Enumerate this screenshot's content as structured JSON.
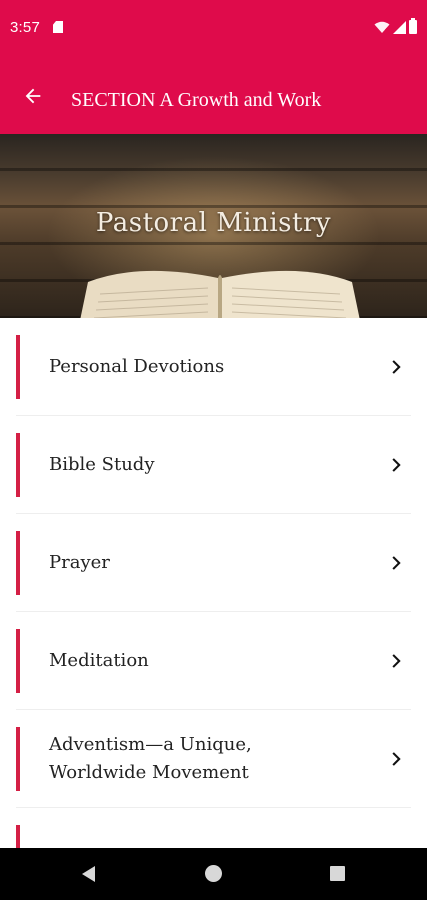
{
  "status": {
    "time": "3:57",
    "color": "#df0b4b"
  },
  "appbar": {
    "title": "SECTION A Growth and Work",
    "back_icon": "arrow-back-icon"
  },
  "hero": {
    "title": "Pastoral Ministry"
  },
  "list": {
    "accent_color": "#d41f45",
    "items": [
      {
        "label": "Personal Devotions"
      },
      {
        "label": "Bible Study"
      },
      {
        "label": "Prayer"
      },
      {
        "label": "Meditation"
      },
      {
        "label": "Adventism—a Unique,\nWorldwide Movement"
      }
    ]
  },
  "navigation": {
    "icons": [
      "nav-back-icon",
      "nav-home-icon",
      "nav-recents-icon"
    ]
  }
}
